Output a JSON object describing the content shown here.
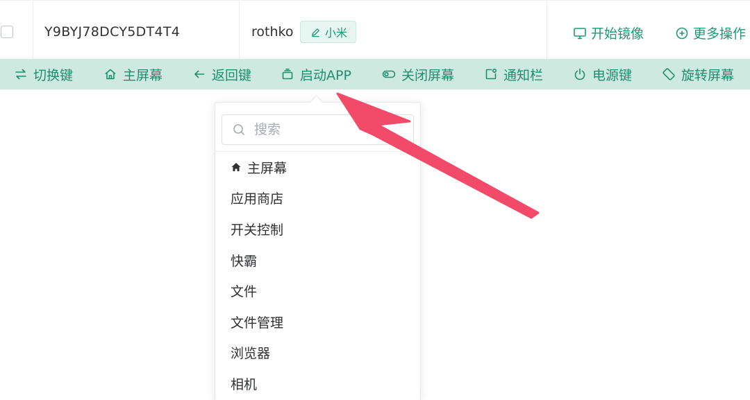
{
  "device": {
    "id": "Y9BYJ78DCY5DT4T4",
    "name": "rothko",
    "brand": "小米",
    "actions": [
      {
        "label": "开始镜像",
        "icon": "monitor-icon"
      },
      {
        "label": "更多操作",
        "icon": "plus-circle-icon"
      }
    ]
  },
  "toolbar": {
    "buttons": [
      {
        "label": "切换键",
        "icon": "switch-icon"
      },
      {
        "label": "主屏幕",
        "icon": "home-icon"
      },
      {
        "label": "返回键",
        "icon": "back-arrow-icon"
      },
      {
        "label": "启动APP",
        "icon": "app-stack-icon"
      },
      {
        "label": "关闭屏幕",
        "icon": "toggle-icon"
      },
      {
        "label": "通知栏",
        "icon": "notification-icon"
      },
      {
        "label": "电源键",
        "icon": "power-icon"
      },
      {
        "label": "旋转屏幕",
        "icon": "rotate-icon"
      }
    ]
  },
  "app_dropdown": {
    "search_placeholder": "搜索",
    "items": [
      {
        "label": "主屏幕",
        "icon": "home-filled-icon"
      },
      {
        "label": "应用商店"
      },
      {
        "label": "开关控制"
      },
      {
        "label": "快霸"
      },
      {
        "label": "文件"
      },
      {
        "label": "文件管理"
      },
      {
        "label": "浏览器"
      },
      {
        "label": "相机"
      }
    ]
  },
  "colors": {
    "accent": "#1b9a75",
    "toolbar_bg": "#cde9e0",
    "tag_bg": "#e8f6f2",
    "annotation_arrow": "#f24a68"
  }
}
